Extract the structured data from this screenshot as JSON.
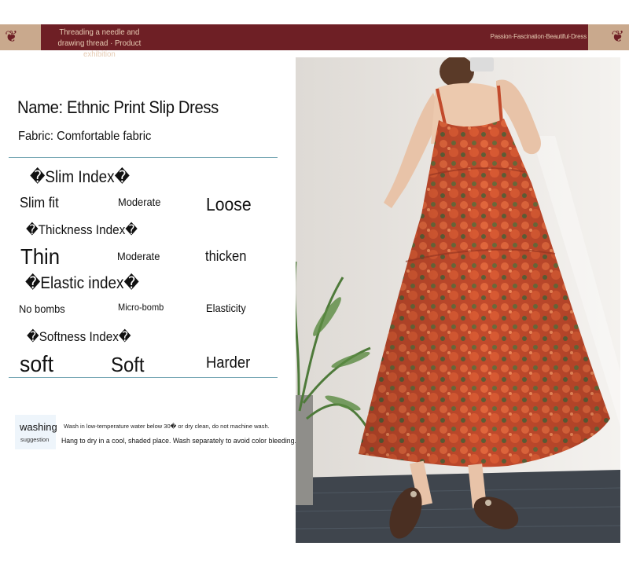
{
  "banner": {
    "left_text": "Threading a needle and drawing thread · Product exhibition",
    "right_text": "Passion·Fascination·Beautiful·Dress",
    "colors": {
      "background": "#6e1f25",
      "ornament": "#c9a98d",
      "text": "#e6cbb3"
    },
    "ornament_glyph": "❦"
  },
  "product": {
    "name": "Name: Ethnic Print Slip Dress",
    "fabric": "Fabric: Comfortable fabric"
  },
  "indexes": [
    {
      "title": "�Slim Index�",
      "options": [
        "Slim fit",
        "Moderate",
        "Loose"
      ]
    },
    {
      "title": "�Thickness Index�",
      "options": [
        "Thin",
        "Moderate",
        "thicken"
      ]
    },
    {
      "title": "�Elastic index�",
      "options": [
        "No bombs",
        "Micro-bomb",
        "Elasticity"
      ]
    },
    {
      "title": "�Softness Index�",
      "options": [
        "soft",
        "Soft",
        "Harder"
      ]
    }
  ],
  "washing": {
    "label": "washing",
    "sublabel": "suggestion",
    "line1": "Wash in low-temperature water below 30� or dry clean, do not machine wash.",
    "line2": "Hang to dry in a cool, shaded place. Wash separately to avoid color bleeding."
  },
  "photo": {
    "subject": "model-wearing-orange-floral-slip-dress",
    "colors": {
      "dress": "#c8512f",
      "wall": "#ebe8e4",
      "floor": "#3f454d"
    }
  }
}
